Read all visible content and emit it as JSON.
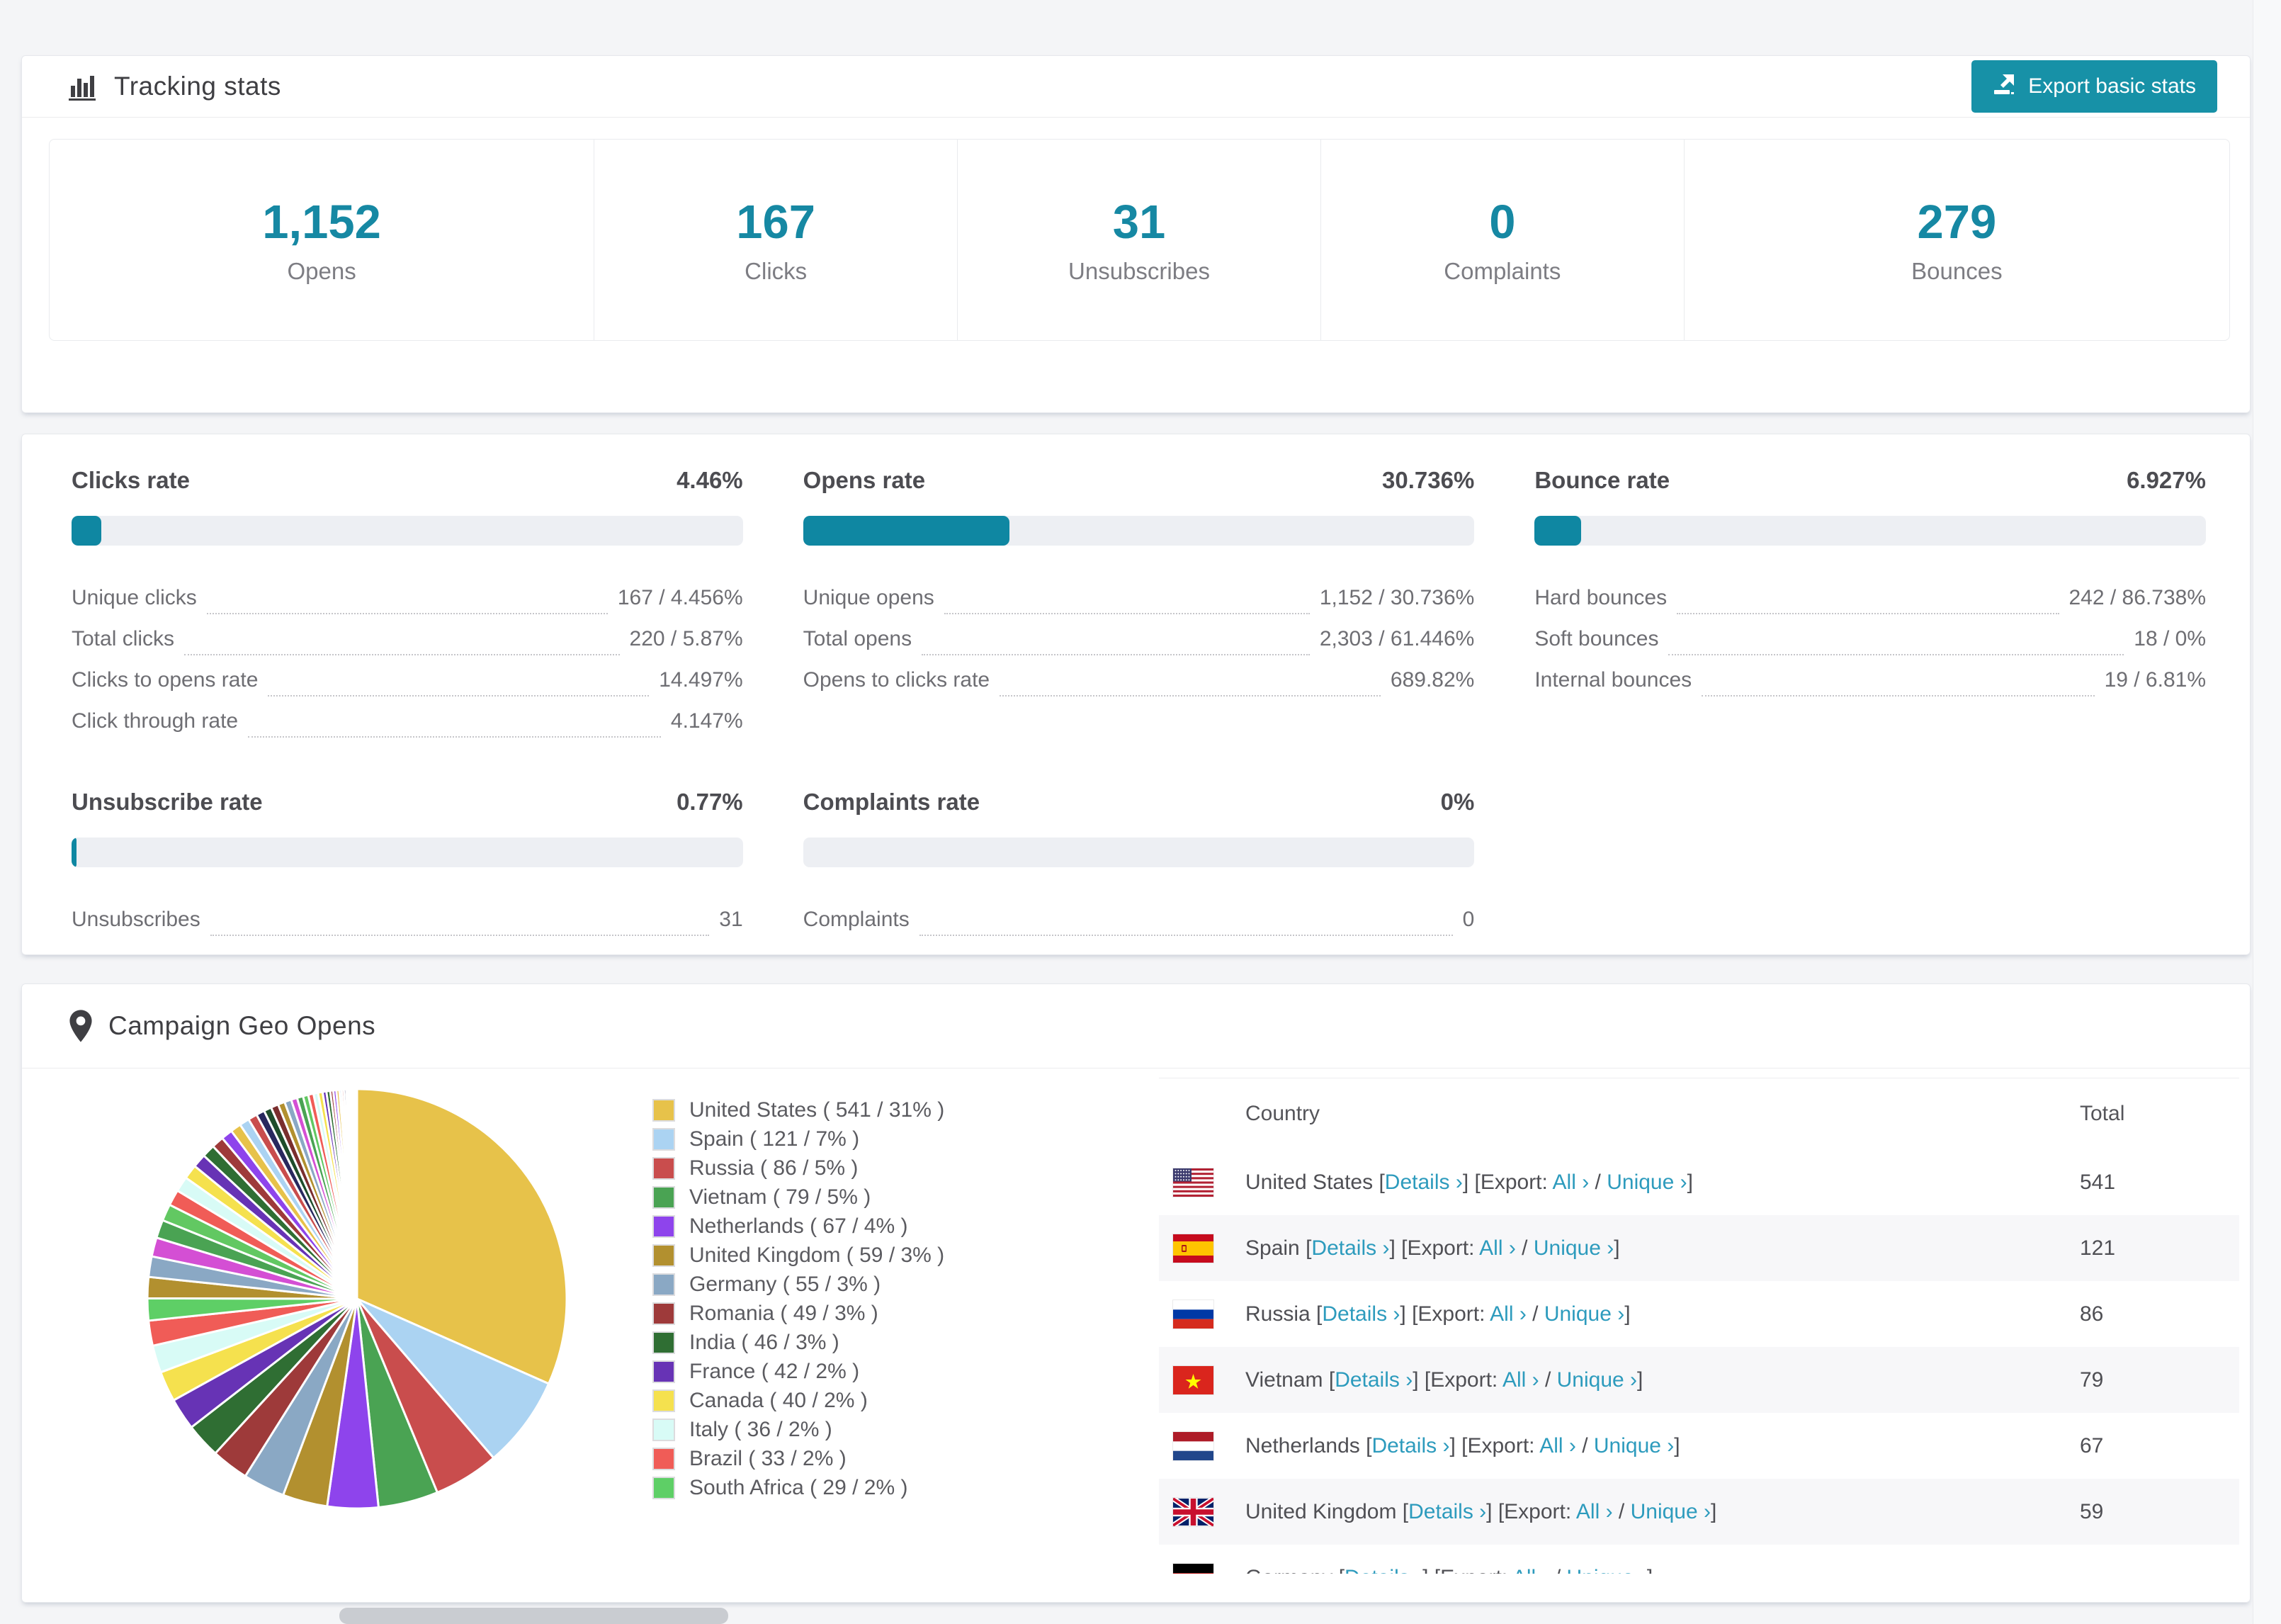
{
  "tracking": {
    "title": "Tracking stats",
    "export_button": "Export basic stats",
    "summary": [
      {
        "value": "1,152",
        "label": "Opens"
      },
      {
        "value": "167",
        "label": "Clicks"
      },
      {
        "value": "31",
        "label": "Unsubscribes"
      },
      {
        "value": "0",
        "label": "Complaints"
      },
      {
        "value": "279",
        "label": "Bounces"
      }
    ]
  },
  "rates": [
    {
      "title": "Clicks rate",
      "value": "4.46%",
      "percent": 4.46,
      "rows": [
        {
          "label": "Unique clicks",
          "value": "167 / 4.456%"
        },
        {
          "label": "Total clicks",
          "value": "220 / 5.87%"
        },
        {
          "label": "Clicks to opens rate",
          "value": "14.497%"
        },
        {
          "label": "Click through rate",
          "value": "4.147%"
        }
      ]
    },
    {
      "title": "Opens rate",
      "value": "30.736%",
      "percent": 30.736,
      "rows": [
        {
          "label": "Unique opens",
          "value": "1,152 / 30.736%"
        },
        {
          "label": "Total opens",
          "value": "2,303 / 61.446%"
        },
        {
          "label": "Opens to clicks rate",
          "value": "689.82%"
        }
      ]
    },
    {
      "title": "Bounce rate",
      "value": "6.927%",
      "percent": 6.927,
      "rows": [
        {
          "label": "Hard bounces",
          "value": "242 / 86.738%"
        },
        {
          "label": "Soft bounces",
          "value": "18 / 0%"
        },
        {
          "label": "Internal bounces",
          "value": "19 / 6.81%"
        }
      ]
    },
    {
      "title": "Unsubscribe rate",
      "value": "0.77%",
      "percent": 0.77,
      "rows": [
        {
          "label": "Unsubscribes",
          "value": "31"
        }
      ]
    },
    {
      "title": "Complaints rate",
      "value": "0%",
      "percent": 0,
      "rows": [
        {
          "label": "Complaints",
          "value": "0"
        }
      ]
    }
  ],
  "geo": {
    "title": "Campaign Geo Opens",
    "columns": {
      "country": "Country",
      "total": "Total"
    },
    "links": {
      "details": "Details ›",
      "export_prefix": "Export:",
      "all": "All ›",
      "unique": "Unique ›"
    },
    "rows": [
      {
        "country": "United States",
        "flag": "us",
        "total": "541"
      },
      {
        "country": "Spain",
        "flag": "es",
        "total": "121"
      },
      {
        "country": "Russia",
        "flag": "ru",
        "total": "86"
      },
      {
        "country": "Vietnam",
        "flag": "vn",
        "total": "79"
      },
      {
        "country": "Netherlands",
        "flag": "nl",
        "total": "67"
      },
      {
        "country": "United Kingdom",
        "flag": "gb",
        "total": "59"
      },
      {
        "country": "Germany",
        "flag": "de",
        "total": "",
        "partial": true
      }
    ]
  },
  "chart_data": {
    "type": "pie",
    "title": "Campaign Geo Opens",
    "legend_position": "right",
    "series": [
      {
        "name": "United States",
        "value": 541,
        "pct": "31%",
        "color": "#e7c24a"
      },
      {
        "name": "Spain",
        "value": 121,
        "pct": "7%",
        "color": "#abd3f2"
      },
      {
        "name": "Russia",
        "value": 86,
        "pct": "5%",
        "color": "#c94d4d"
      },
      {
        "name": "Vietnam",
        "value": 79,
        "pct": "5%",
        "color": "#4aa353"
      },
      {
        "name": "Netherlands",
        "value": 67,
        "pct": "4%",
        "color": "#8e44ec"
      },
      {
        "name": "United Kingdom",
        "value": 59,
        "pct": "3%",
        "color": "#b2902f"
      },
      {
        "name": "Germany",
        "value": 55,
        "pct": "3%",
        "color": "#8aa8c4"
      },
      {
        "name": "Romania",
        "value": 49,
        "pct": "3%",
        "color": "#9e3a3a"
      },
      {
        "name": "India",
        "value": 46,
        "pct": "3%",
        "color": "#2f6e33"
      },
      {
        "name": "France",
        "value": 42,
        "pct": "2%",
        "color": "#6733b5"
      },
      {
        "name": "Canada",
        "value": 40,
        "pct": "2%",
        "color": "#f5e14e"
      },
      {
        "name": "Italy",
        "value": 36,
        "pct": "2%",
        "color": "#d8fbf6"
      },
      {
        "name": "Brazil",
        "value": 33,
        "pct": "2%",
        "color": "#f05c57"
      },
      {
        "name": "South Africa",
        "value": 29,
        "pct": "2%",
        "color": "#5ecf66"
      }
    ],
    "others_values": [
      28,
      27,
      25,
      24,
      22,
      21,
      20,
      19,
      18,
      17,
      16,
      15,
      14,
      13,
      12,
      11,
      10,
      10,
      9,
      9,
      8,
      8,
      7,
      7,
      6,
      6,
      5,
      5,
      4,
      4,
      4,
      3,
      3,
      3,
      2,
      2,
      2,
      2,
      1,
      1,
      1,
      1,
      1,
      1
    ],
    "others_colors": [
      "#b2902f",
      "#8aa8c4",
      "#d44fd4",
      "#4aa353",
      "#62c862",
      "#f05c57",
      "#d8fbf6",
      "#f5e14e",
      "#6733b5",
      "#2f6e33",
      "#9e3a3a",
      "#8e44ec",
      "#e7c24a",
      "#abd3f2",
      "#c94d4d",
      "#28285e",
      "#1e4d2b",
      "#7a2e2e"
    ]
  },
  "colors": {
    "accent": "#1791a7",
    "link": "#2d9bbd",
    "bar_fill": "#0f87a2",
    "bar_track": "#edeff3",
    "stat_number": "#1688a3"
  }
}
